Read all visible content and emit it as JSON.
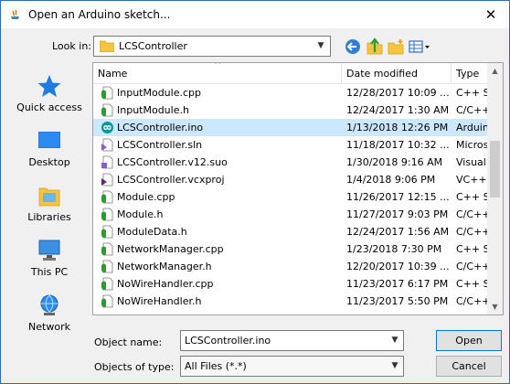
{
  "window": {
    "title": "Open an Arduino sketch...",
    "close_glyph": "✕"
  },
  "toolbar": {
    "lookin_label": "Look in:",
    "lookin_value": "LCSController",
    "buttons": [
      "back-icon",
      "up-folder-icon",
      "new-folder-icon",
      "view-menu-icon"
    ]
  },
  "places": [
    {
      "label": "Quick access",
      "icon": "star-icon"
    },
    {
      "label": "Desktop",
      "icon": "desktop-icon"
    },
    {
      "label": "Libraries",
      "icon": "libraries-icon"
    },
    {
      "label": "This PC",
      "icon": "computer-icon"
    },
    {
      "label": "Network",
      "icon": "network-icon"
    }
  ],
  "columns": {
    "name": "Name",
    "date": "Date modified",
    "type": "Type"
  },
  "files": [
    {
      "name": "InputModule.cpp",
      "date": "12/28/2017 10:09 ...",
      "type": "C++ Sc",
      "icon": "cpp-file-icon",
      "selected": false
    },
    {
      "name": "InputModule.h",
      "date": "12/24/2017 1:30 AM",
      "type": "C/C++",
      "icon": "header-file-icon",
      "selected": false
    },
    {
      "name": "LCSController.ino",
      "date": "1/13/2018 12:26 PM",
      "type": "Arduin",
      "icon": "arduino-file-icon",
      "selected": true
    },
    {
      "name": "LCSController.sln",
      "date": "11/18/2017 10:32 ...",
      "type": "Micros",
      "icon": "solution-file-icon",
      "selected": false
    },
    {
      "name": "LCSController.v12.suo",
      "date": "1/30/2018 9:16 AM",
      "type": "Visual",
      "icon": "suo-file-icon",
      "selected": false
    },
    {
      "name": "LCSController.vcxproj",
      "date": "1/4/2018 9:06 PM",
      "type": "VC++",
      "icon": "vcxproj-file-icon",
      "selected": false
    },
    {
      "name": "Module.cpp",
      "date": "11/26/2017 12:15 ...",
      "type": "C++ Sc",
      "icon": "cpp-file-icon",
      "selected": false
    },
    {
      "name": "Module.h",
      "date": "11/27/2017 9:03 PM",
      "type": "C/C++",
      "icon": "header-file-icon",
      "selected": false
    },
    {
      "name": "ModuleData.h",
      "date": "12/24/2017 1:56 AM",
      "type": "C/C++",
      "icon": "header-file-icon",
      "selected": false
    },
    {
      "name": "NetworkManager.cpp",
      "date": "1/23/2018 7:30 PM",
      "type": "C++ Sc",
      "icon": "cpp-file-icon",
      "selected": false
    },
    {
      "name": "NetworkManager.h",
      "date": "12/20/2017 10:39 ...",
      "type": "C/C++",
      "icon": "header-file-icon",
      "selected": false
    },
    {
      "name": "NoWireHandler.cpp",
      "date": "11/23/2017 6:17 PM",
      "type": "C++ Sc",
      "icon": "cpp-file-icon",
      "selected": false
    },
    {
      "name": "NoWireHandler.h",
      "date": "11/23/2017 5:50 PM",
      "type": "C/C++",
      "icon": "header-file-icon",
      "selected": false
    }
  ],
  "form": {
    "object_name_label": "Object name:",
    "object_name_value": "LCSController.ino",
    "object_type_label": "Objects of type:",
    "object_type_value": "All Files (*.*)"
  },
  "buttons": {
    "open": "Open",
    "cancel": "Cancel"
  },
  "colors": {
    "selection": "#cce8ff",
    "accent": "#0078d7",
    "window_border": "#2b66c9"
  }
}
